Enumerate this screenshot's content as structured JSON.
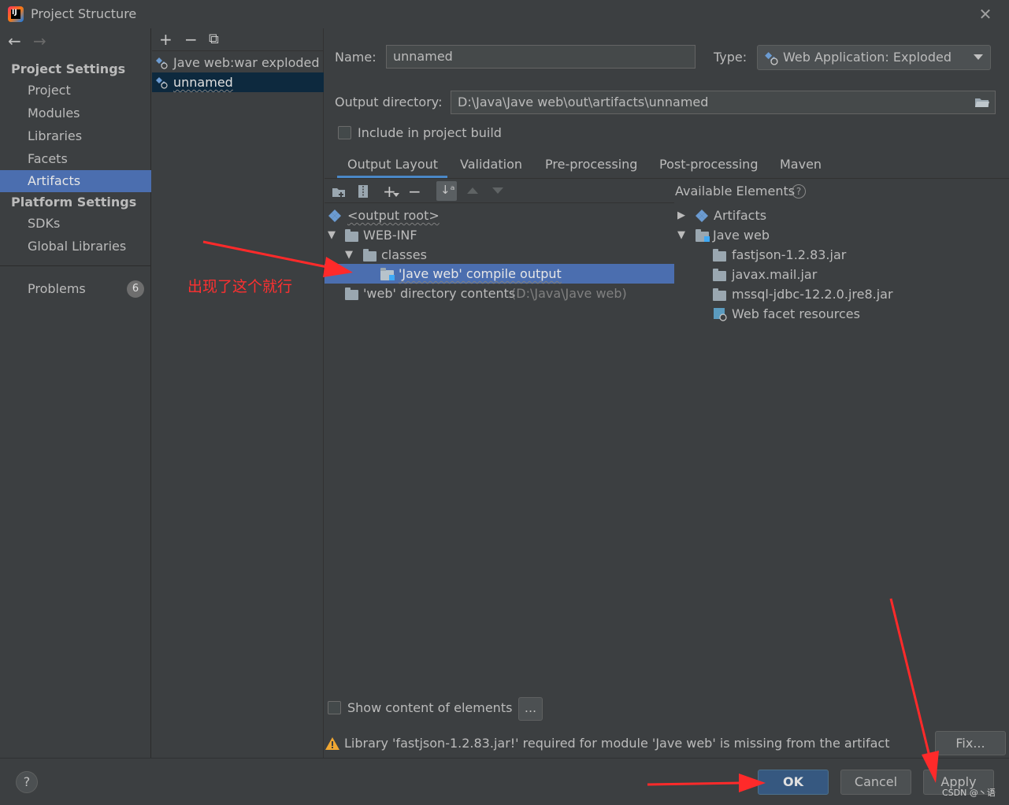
{
  "window": {
    "title": "Project Structure",
    "close_glyph": "✕"
  },
  "nav": {
    "back": "←",
    "forward": "→",
    "project_settings_title": "Project Settings",
    "project_items": [
      "Project",
      "Modules",
      "Libraries",
      "Facets",
      "Artifacts"
    ],
    "active_item": "Artifacts",
    "platform_settings_title": "Platform Settings",
    "platform_items": [
      "SDKs",
      "Global Libraries"
    ],
    "problems_label": "Problems",
    "problems_count": "6"
  },
  "artifact_list": {
    "add": "+",
    "remove": "−",
    "copy": "⧉",
    "items": [
      "Jave web:war exploded",
      "unnamed"
    ],
    "selected": "unnamed"
  },
  "form": {
    "name_label": "Name:",
    "name_value": "unnamed",
    "type_label": "Type:",
    "type_value": "Web Application: Exploded",
    "output_label": "Output directory:",
    "output_value": "D:\\Java\\Jave web\\out\\artifacts\\unnamed",
    "include_label": "Include in project build",
    "include_checked": false
  },
  "tabs": [
    "Output Layout",
    "Validation",
    "Pre-processing",
    "Post-processing",
    "Maven"
  ],
  "active_tab": "Output Layout",
  "layout_tree": {
    "root": "<output root>",
    "web_inf": "WEB-INF",
    "classes": "classes",
    "compile_output": "'Jave web' compile output",
    "web_dir": "'web' directory contents",
    "web_dir_path": "(D:\\Java\\Jave web)"
  },
  "available": {
    "title": "Available Elements",
    "help": "?",
    "artifacts": "Artifacts",
    "module": "Jave web",
    "children": [
      "fastjson-1.2.83.jar",
      "javax.mail.jar",
      "mssql-jdbc-12.2.0.jre8.jar",
      "Web facet resources"
    ]
  },
  "footer": {
    "show_content_label": "Show content of elements",
    "ellipsis": "...",
    "warning": "Library 'fastjson-1.2.83.jar!' required for module 'Jave web' is missing from the artifact",
    "fix": "Fix...",
    "ok": "OK",
    "cancel": "Cancel",
    "apply": "Apply",
    "help": "?"
  },
  "annotation": {
    "text": "出现了这个就行",
    "color": "#ff3030"
  },
  "watermark": "CSDN @丶语",
  "colors": {
    "background": "#3c3f41",
    "selection": "#4b6eaf",
    "list_selection": "#0d293e",
    "primary_button": "#365880",
    "tab_underline": "#4a88c7"
  }
}
